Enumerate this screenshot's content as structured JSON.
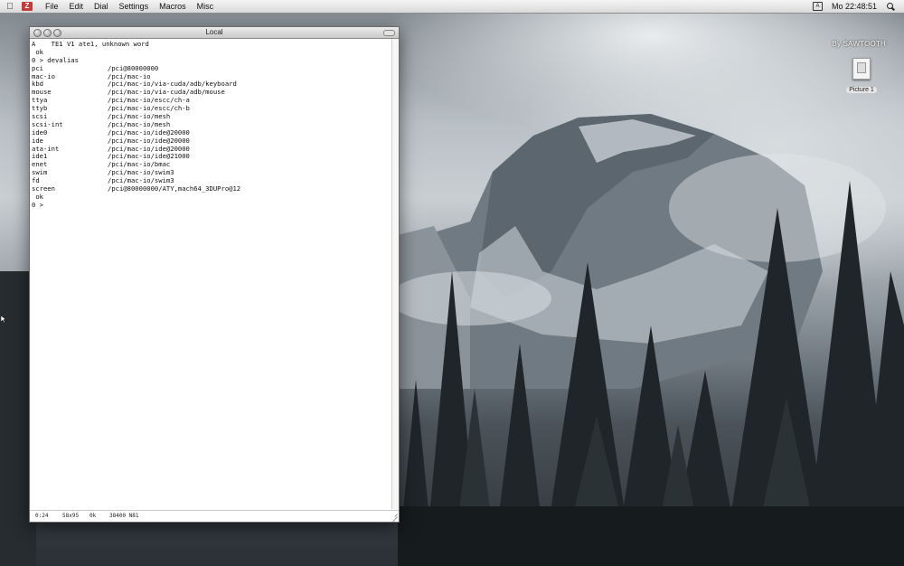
{
  "menubar": {
    "apple": "",
    "app_icon": "Z",
    "items": [
      "File",
      "Edit",
      "Dial",
      "Settings",
      "Macros",
      "Misc"
    ],
    "clock": "Mo 22:48:51"
  },
  "desktop": {
    "brand": "By SAWTOOTH",
    "icon_label": "Picture 1"
  },
  "window": {
    "title": "Local",
    "terminal": {
      "intro": [
        "A    TE1 V1 ate1, unknown word",
        " ok",
        "0 > devalias"
      ],
      "aliases": [
        [
          "pci",
          "/pci@80000000"
        ],
        [
          "mac-io",
          "/pci/mac-io"
        ],
        [
          "kbd",
          "/pci/mac-io/via-cuda/adb/keyboard"
        ],
        [
          "mouse",
          "/pci/mac-io/via-cuda/adb/mouse"
        ],
        [
          "ttya",
          "/pci/mac-io/escc/ch-a"
        ],
        [
          "ttyb",
          "/pci/mac-io/escc/ch-b"
        ],
        [
          "scsi",
          "/pci/mac-io/mesh"
        ],
        [
          "scsi-int",
          "/pci/mac-io/mesh"
        ],
        [
          "ide0",
          "/pci/mac-io/ide@20000"
        ],
        [
          "ide",
          "/pci/mac-io/ide@20000"
        ],
        [
          "ata-int",
          "/pci/mac-io/ide@20000"
        ],
        [
          "ide1",
          "/pci/mac-io/ide@21000"
        ],
        [
          "enet",
          "/pci/mac-io/bmac"
        ],
        [
          "swim",
          "/pci/mac-io/swim3"
        ],
        [
          "fd",
          "/pci/mac-io/swim3"
        ],
        [
          "screen",
          "/pci@80000000/ATY,mach64_3DUPro@12"
        ]
      ],
      "outro": [
        " ok",
        "0 >"
      ]
    },
    "status": {
      "time": "0:24",
      "size": "58x95",
      "state": "0k",
      "baud": "38400 N81"
    }
  }
}
